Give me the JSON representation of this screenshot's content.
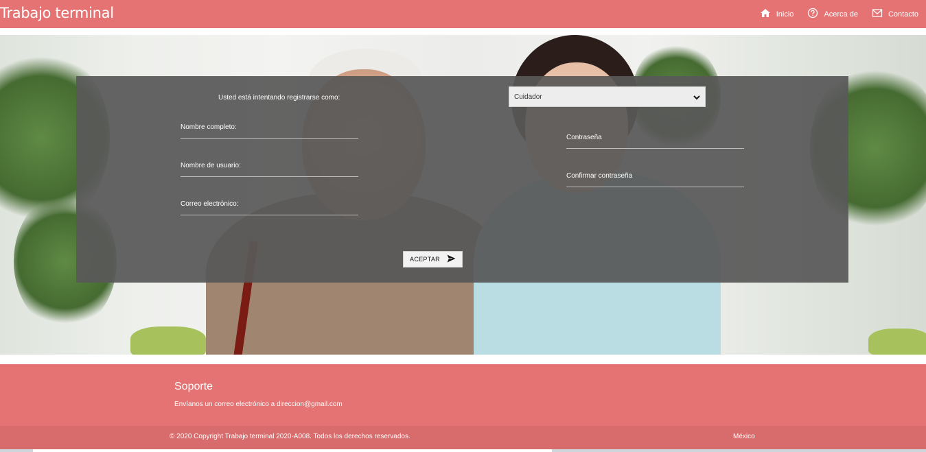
{
  "header": {
    "brand": "Trabajo terminal",
    "nav": [
      {
        "label": "Inicio",
        "icon": "home-icon"
      },
      {
        "label": "Acerca de",
        "icon": "help-circle-icon"
      },
      {
        "label": "Contacto",
        "icon": "mail-icon"
      }
    ]
  },
  "form": {
    "role_prompt": "Usted está intentando registrarse como:",
    "role_select_value": "Cuidador",
    "fields_left": [
      "Nombre completo:",
      "Nombre de usuario:",
      "Correo electrónico:"
    ],
    "fields_right": [
      "Contraseña",
      "Confirmar contraseña"
    ],
    "submit_label": "ACEPTAR"
  },
  "footer": {
    "title": "Soporte",
    "text": "Envíanos un correo electrónico a direccion@gmail.com",
    "copyright": "© 2020 Copyright Trabajo terminal 2020-A008. Todos los derechos reservados.",
    "country": "México"
  },
  "colors": {
    "accent": "#e57373",
    "bottom_bar": "#d86b6b",
    "panel": "#585858"
  }
}
